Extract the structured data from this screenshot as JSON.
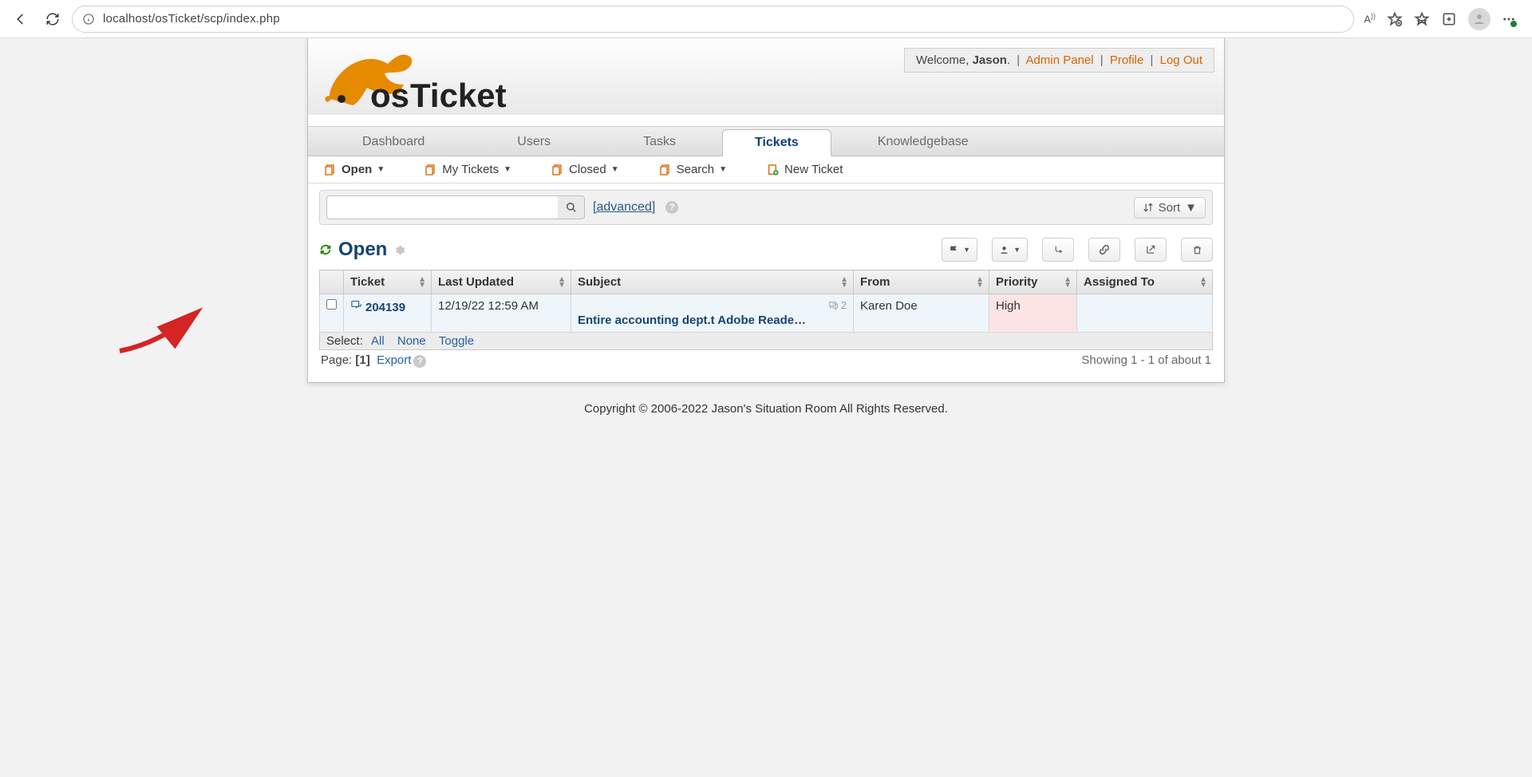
{
  "browser": {
    "url": "localhost/osTicket/scp/index.php"
  },
  "header": {
    "welcome_prefix": "Welcome, ",
    "user_name": "Jason",
    "welcome_suffix": ". ",
    "links": {
      "admin_panel": "Admin Panel",
      "profile": "Profile",
      "logout": "Log Out"
    }
  },
  "main_tabs": {
    "dashboard": "Dashboard",
    "users": "Users",
    "tasks": "Tasks",
    "tickets": "Tickets",
    "knowledgebase": "Knowledgebase"
  },
  "subnav": {
    "open": "Open",
    "my_tickets": "My Tickets",
    "closed": "Closed",
    "search": "Search",
    "new_ticket": "New Ticket"
  },
  "search": {
    "advanced": "[advanced]",
    "sort": "Sort"
  },
  "page_title": "Open",
  "table": {
    "columns": {
      "ticket": "Ticket",
      "updated": "Last Updated",
      "subject": "Subject",
      "from": "From",
      "priority": "Priority",
      "assigned": "Assigned To"
    },
    "rows": [
      {
        "id": "204139",
        "updated": "12/19/22 12:59 AM",
        "subject": "Entire accounting dept.t Adobe Reade…",
        "replies": "2",
        "from": "Karen Doe",
        "priority": "High",
        "assigned": ""
      }
    ]
  },
  "footer": {
    "select_label": "Select:",
    "all": "All",
    "none": "None",
    "toggle": "Toggle",
    "page_label": "Page: ",
    "page_current": "[1]",
    "export": "Export",
    "showing": "Showing 1 - 1 of about 1"
  },
  "copyright": "Copyright © 2006-2022 Jason's Situation Room All Rights Reserved."
}
